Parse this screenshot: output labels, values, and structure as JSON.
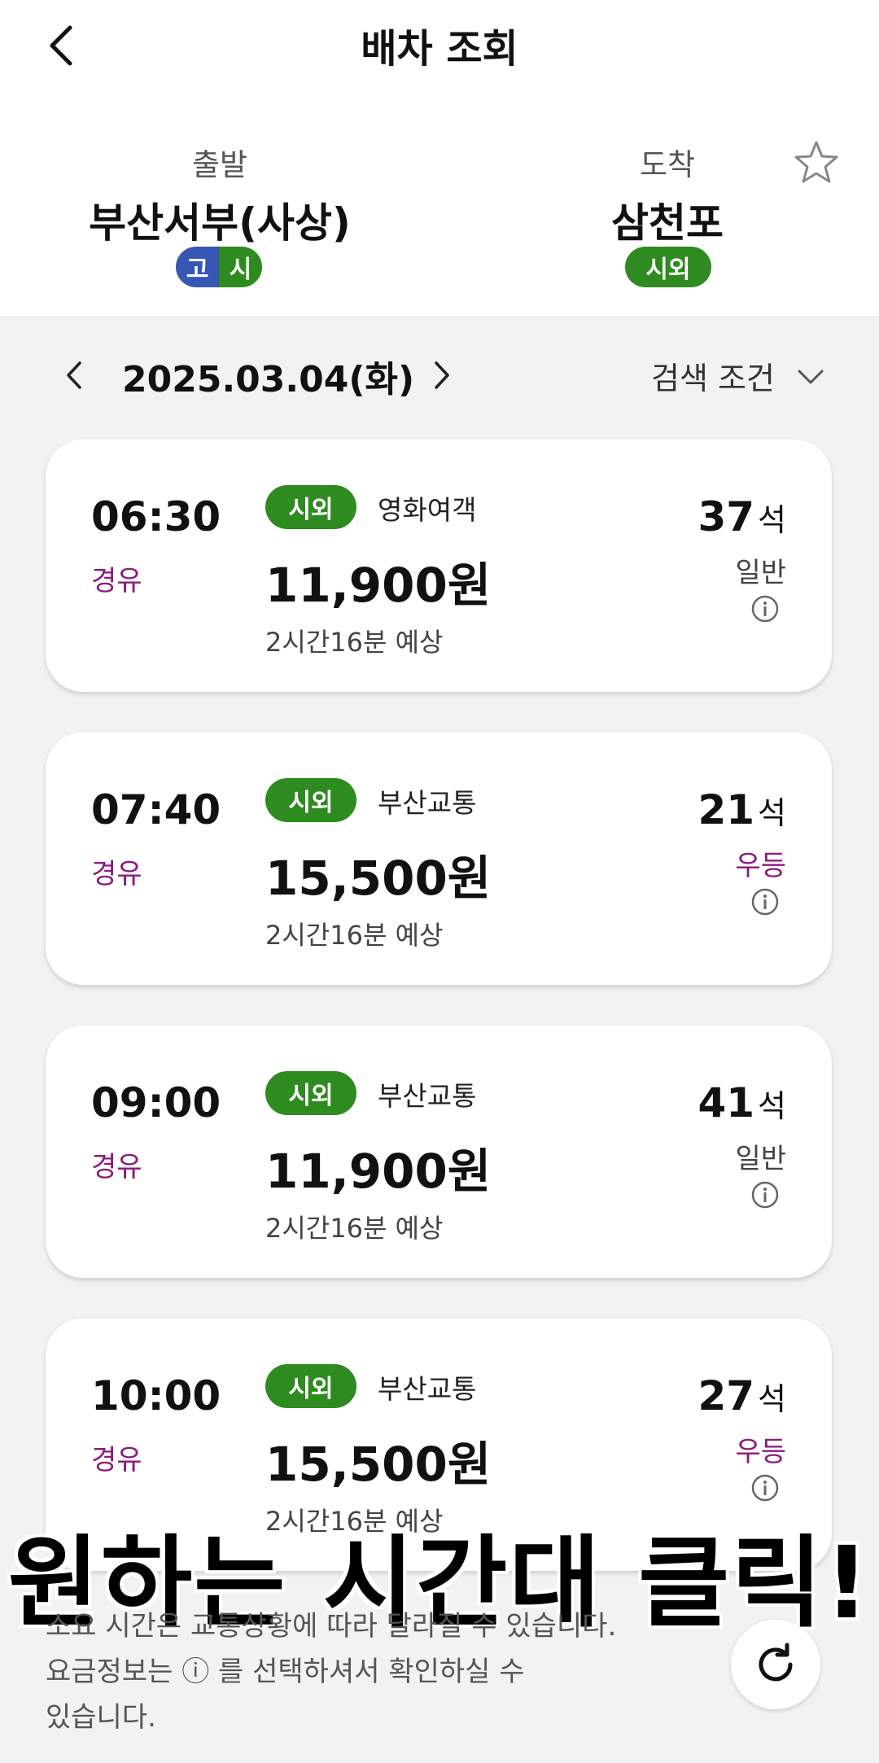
{
  "header": {
    "title": "배차 조회",
    "back_icon": "chevron-left-icon",
    "favorite_icon": "star-icon"
  },
  "route": {
    "departure_label": "출발",
    "departure_name": "부산서부(사상)",
    "departure_tags": [
      "고",
      "시"
    ],
    "arrival_label": "도착",
    "arrival_name": "삼천포",
    "arrival_tag": "시외"
  },
  "datebar": {
    "date": "2025.03.04(화)",
    "search_conditions": "검색 조건"
  },
  "schedules": [
    {
      "time": "06:30",
      "via": "경유",
      "type": "시외",
      "company": "영화여객",
      "fare": "11,900원",
      "duration": "2시간16분 예상",
      "seats": "37",
      "seat_unit": "석",
      "grade": "일반"
    },
    {
      "time": "07:40",
      "via": "경유",
      "type": "시외",
      "company": "부산교통",
      "fare": "15,500원",
      "duration": "2시간16분 예상",
      "seats": "21",
      "seat_unit": "석",
      "grade": "우등"
    },
    {
      "time": "09:00",
      "via": "경유",
      "type": "시외",
      "company": "부산교통",
      "fare": "11,900원",
      "duration": "2시간16분 예상",
      "seats": "41",
      "seat_unit": "석",
      "grade": "일반"
    },
    {
      "time": "10:00",
      "via": "경유",
      "type": "시외",
      "company": "부산교통",
      "fare": "15,500원",
      "duration": "2시간16분 예상",
      "seats": "27",
      "seat_unit": "석",
      "grade": "우등"
    }
  ],
  "overlay_caption": "원하는 시간대 클릭!",
  "footer": {
    "note_line1": "소요 시간은 교통상황에 따라 달라질 수 있습니다.",
    "note_line2": "요금정보는 ⓘ 를 선택하셔서 확인하실 수",
    "note_line3": "있습니다."
  },
  "colors": {
    "green": "#2e8b1f",
    "blue": "#3856b4",
    "purple": "#8a1a7c"
  }
}
